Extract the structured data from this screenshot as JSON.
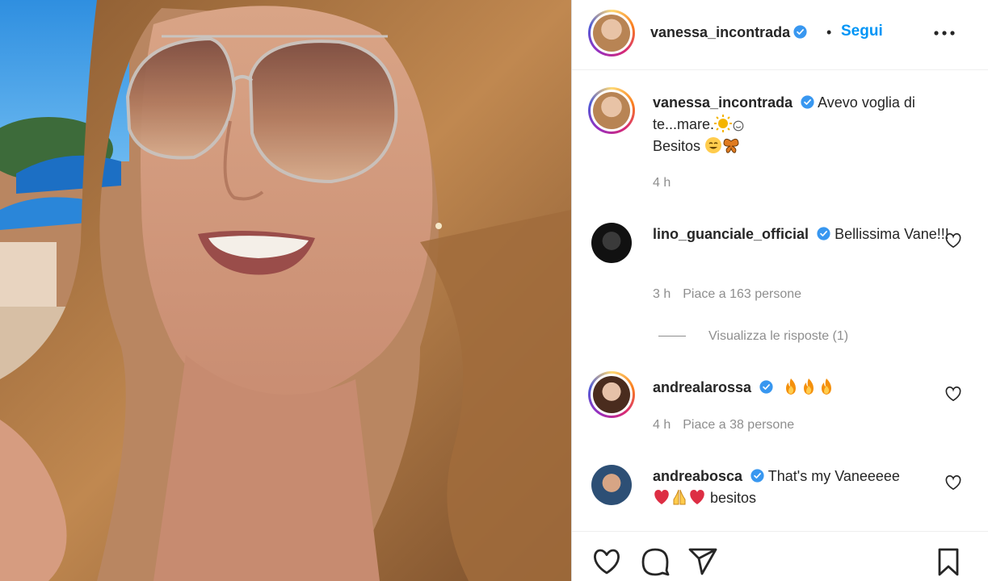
{
  "post": {
    "author": "vanessa_incontrada",
    "follow_label": "Segui",
    "separator": "•",
    "more_label": "..."
  },
  "caption": {
    "username": "vanessa_incontrada",
    "text_line1": "Avevo voglia di te...mare.",
    "text_line2": "Besitos",
    "time": "4 h"
  },
  "comments": [
    {
      "username": "lino_guanciale_official",
      "text": "Bellissima Vane!!!",
      "time": "3 h",
      "likes": "Piace a 163 persone"
    },
    {
      "username": "andrealarossa",
      "text": "",
      "time": "4 h",
      "likes": "Piace a 38 persone"
    },
    {
      "username": "andreabosca",
      "text": "That's my Vaneeeee",
      "text_after": "besitos"
    }
  ],
  "view_replies": "Visualizza le risposte (1)",
  "colors": {
    "accent": "#0095f6",
    "verified": "#3897f0",
    "muted": "#8e8e8e",
    "text": "#262626"
  },
  "icons": [
    "verified-icon",
    "more-icon",
    "heart-icon",
    "comment-icon",
    "share-icon",
    "bookmark-icon",
    "sun-emoji",
    "smile-emoji",
    "butterfly-emoji",
    "fire-emoji",
    "red-heart-emoji",
    "praying-hands-emoji"
  ]
}
